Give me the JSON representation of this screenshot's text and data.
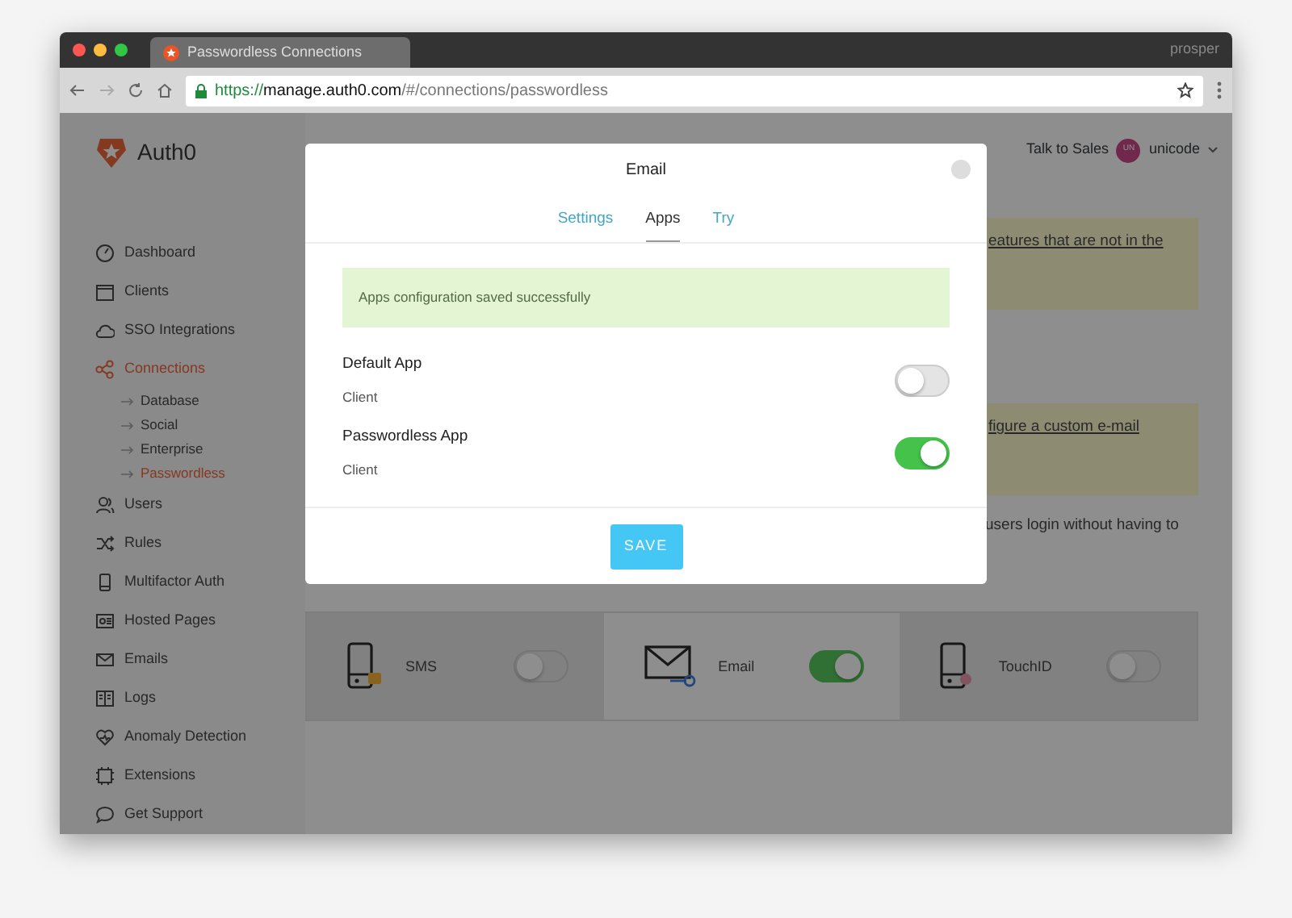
{
  "browser": {
    "tab_title": "Passwordless Connections",
    "profile": "prosper",
    "url": {
      "scheme": "https://",
      "host": "manage.auth0.com",
      "path": "/#/connections/passwordless"
    }
  },
  "app": {
    "logo": "Auth0",
    "sidebar": [
      {
        "label": "Dashboard",
        "selected": false
      },
      {
        "label": "Clients",
        "selected": false
      },
      {
        "label": "SSO Integrations",
        "selected": false
      },
      {
        "label": "Connections",
        "selected": true,
        "children": [
          {
            "label": "Database",
            "selected": false
          },
          {
            "label": "Social",
            "selected": false
          },
          {
            "label": "Enterprise",
            "selected": false
          },
          {
            "label": "Passwordless",
            "selected": true
          }
        ]
      },
      {
        "label": "Users",
        "selected": false
      },
      {
        "label": "Rules",
        "selected": false
      },
      {
        "label": "Multifactor Auth",
        "selected": false
      },
      {
        "label": "Hosted Pages",
        "selected": false
      },
      {
        "label": "Emails",
        "selected": false
      },
      {
        "label": "Logs",
        "selected": false
      },
      {
        "label": "Anomaly Detection",
        "selected": false
      },
      {
        "label": "Extensions",
        "selected": false
      },
      {
        "label": "Get Support",
        "selected": false
      }
    ],
    "header": {
      "link": "Talk to Sales",
      "avatar": "UN",
      "user": "unicode"
    },
    "notices": [
      "eatures that are not in the",
      "figure a custom e-mail"
    ],
    "description": "users login without having to",
    "connections": [
      {
        "name": "SMS",
        "kind": "sms",
        "on": false,
        "selected": false
      },
      {
        "name": "Email",
        "kind": "email",
        "on": true,
        "selected": true
      },
      {
        "name": "TouchID",
        "kind": "touchid",
        "on": false,
        "selected": false
      }
    ]
  },
  "modal": {
    "title": "Email",
    "tabs": [
      {
        "label": "Settings",
        "selected": false
      },
      {
        "label": "Apps",
        "selected": true
      },
      {
        "label": "Try",
        "selected": false
      }
    ],
    "alert": "Apps configuration saved successfully",
    "apps": [
      {
        "name": "Default App",
        "type": "Client",
        "on": false
      },
      {
        "name": "Passwordless App",
        "type": "Client",
        "on": true
      }
    ],
    "save": "SAVE"
  }
}
